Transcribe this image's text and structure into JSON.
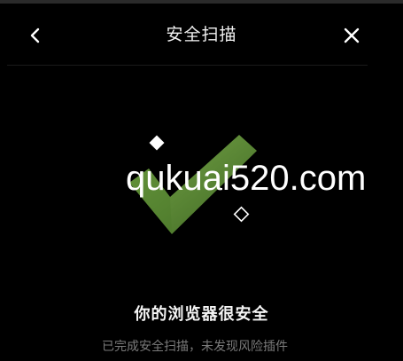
{
  "header": {
    "title": "安全扫描",
    "back_icon": "chevron-left-icon",
    "close_icon": "close-icon"
  },
  "result": {
    "headline": "你的浏览器很安全",
    "subtext": "已完成安全扫描，未发现风险插件"
  },
  "watermark": "qukuai520.com",
  "colors": {
    "background": "#000000",
    "check_light": "#6a9a3c",
    "check_dark": "#3f6a22",
    "muted_text": "#7a7a7a"
  }
}
